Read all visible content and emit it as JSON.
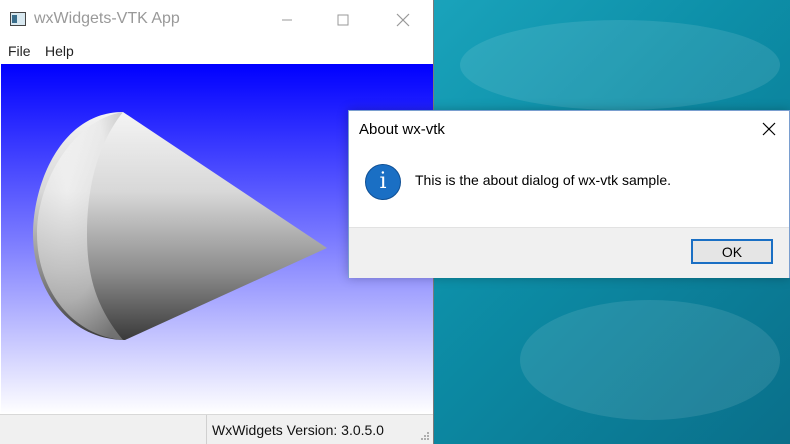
{
  "main_window": {
    "title": "wxWidgets-VTK App",
    "menu": [
      "File",
      "Help"
    ],
    "status_text": "WxWidgets Version: 3.0.5.0"
  },
  "dialog": {
    "title": "About wx-vtk",
    "message": "This is the about dialog of wx-vtk sample.",
    "ok_label": "OK"
  },
  "icons": {
    "app": "app-icon",
    "minimize": "minimize-icon",
    "maximize": "maximize-icon",
    "close": "close-icon",
    "info": "info-icon",
    "grip": "resize-grip-icon"
  },
  "colors": {
    "vtk_bg_top": "#0000ff",
    "vtk_bg_bottom": "#ffffff",
    "dialog_accent": "#1a6fc4"
  }
}
